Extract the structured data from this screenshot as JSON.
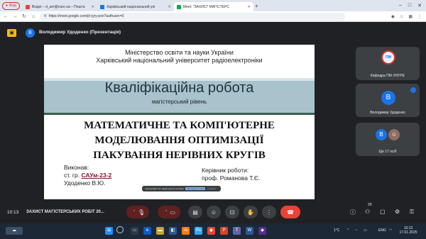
{
  "browser": {
    "profile_label": "Вхід",
    "tabs": [
      {
        "title": "Вхідні – d_am@nure.ua – Пошта",
        "favicon_color": "#ea4335"
      },
      {
        "title": "Харківський національний уні",
        "favicon_color": "#1a73e8"
      },
      {
        "title": "Meet: \"ЗАХИСТ МАГІСТЕРС",
        "favicon_color": "#00ac47"
      }
    ],
    "new_tab": "+",
    "url": "https://meet.google.com/jir-jyry-pxn?authuser=0"
  },
  "meet": {
    "presenter_initial": "В",
    "presenter_label": "Володимир Удоденко (Презентація)",
    "clock": "10:13",
    "meeting_title": "ЗАХИСТ МАГІСТЕРСЬКИХ РОБІТ 20...",
    "participants_count": "20",
    "tiles": [
      {
        "name": "Кафедра ПМ ХНУРЕ",
        "logo_text": "ПМ"
      },
      {
        "name": "Володимир Удоденко",
        "initial": "В"
      },
      {
        "name": "Ще 17 осіб",
        "initial": "В"
      }
    ]
  },
  "slide": {
    "ministry": "Міністерство освіти та науки України",
    "university": "Харківський національний університет радіоелектроніки",
    "title": "Кваліфікаційна робота",
    "level": "магістерський рівень",
    "topic_lines": [
      "МАТЕМАТИЧНЕ ТА КОМП'ЮТЕРНЕ",
      "МОДЕЛЮВАННЯ ОПТИМІЗАЦІЇ",
      "ПАКУВАННЯ НЕРІВНИХ КРУГІВ"
    ],
    "executor_label": "Виконав:",
    "group_prefix": "ст. гр.",
    "group": "САУм-23-2",
    "executor_name": "Удоденко В.Ю.",
    "supervisor_label": "Керівник роботи:",
    "supervisor_name": "проф. Романова Т.Є."
  },
  "share_bar": {
    "text": "meet.google.com надає доступ до вікна",
    "stop_label": "Припинити показ",
    "hide_label": "Сховати"
  },
  "tray": {
    "temperature": "1°C",
    "language": "ENG",
    "time": "10:13",
    "date": "17.01.2025"
  },
  "colors": {
    "meet_bg": "#202124",
    "end_call": "#ea4335",
    "slide_band": "#a9c3cd",
    "accent_blue": "#1a73e8"
  }
}
